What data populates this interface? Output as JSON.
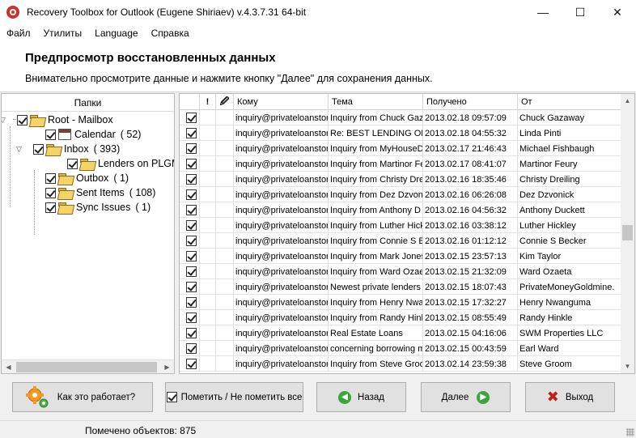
{
  "window": {
    "title": "Recovery Toolbox for Outlook (Eugene Shiriaev) v.4.3.7.31 64-bit",
    "minimize": "—",
    "maximize": "☐",
    "close": "✕"
  },
  "menu": [
    "Файл",
    "Утилиты",
    "Language",
    "Справка"
  ],
  "header": {
    "title": "Предпросмотр восстановленных данных",
    "subtitle": "Внимательно просмотрите данные и нажмите кнопку \"Далее\" для сохранения данных."
  },
  "folders": {
    "header": "Папки",
    "items": [
      {
        "label": "Root - Mailbox",
        "count": "",
        "checked": true,
        "expander": "▽",
        "icon": "folder-icon"
      },
      {
        "label": "Calendar",
        "count": "( 52)",
        "checked": true,
        "expander": "",
        "icon": "calendar-icon"
      },
      {
        "label": "Inbox",
        "count": "( 393)",
        "checked": true,
        "expander": "▽",
        "icon": "folder-icon"
      },
      {
        "label": "Lenders on PLGM",
        "count": "",
        "checked": true,
        "expander": "",
        "icon": "folder-icon"
      },
      {
        "label": "Outbox",
        "count": "( 1)",
        "checked": true,
        "expander": "",
        "icon": "folder-icon"
      },
      {
        "label": "Sent Items",
        "count": "( 108)",
        "checked": true,
        "expander": "",
        "icon": "folder-icon"
      },
      {
        "label": "Sync Issues",
        "count": "( 1)",
        "checked": true,
        "expander": "",
        "icon": "folder-icon"
      }
    ]
  },
  "grid": {
    "columns": [
      "",
      "!",
      "🖉",
      "Кому",
      "Тема",
      "Получено",
      "От"
    ],
    "rows": [
      {
        "to": "inquiry@privateloanstor",
        "subject": "Inquiry from Chuck Gaz",
        "received": "2013.02.18 09:57:09",
        "from": "Chuck Gazaway"
      },
      {
        "to": "inquiry@privateloanstor",
        "subject": "Re: BEST LENDING OPP",
        "received": "2013.02.18 04:55:32",
        "from": "Linda Pinti"
      },
      {
        "to": "inquiry@privateloanstor",
        "subject": "Inquiry from MyHouseD",
        "received": "2013.02.17 21:46:43",
        "from": "Michael Fishbaugh"
      },
      {
        "to": "inquiry@privateloanstor",
        "subject": "Inquiry from Martinor Fe",
        "received": "2013.02.17 08:41:07",
        "from": "Martinor Feury"
      },
      {
        "to": "inquiry@privateloanstor",
        "subject": "Inquiry from Christy Dre",
        "received": "2013.02.16 18:35:46",
        "from": "Christy Dreiling"
      },
      {
        "to": "inquiry@privateloanstor",
        "subject": "Inquiry from Dez Dzvon",
        "received": "2013.02.16 06:26:08",
        "from": "Dez Dzvonick"
      },
      {
        "to": "inquiry@privateloanstor",
        "subject": "Inquiry from Anthony D",
        "received": "2013.02.16 04:56:32",
        "from": "Anthony Duckett"
      },
      {
        "to": "inquiry@privateloanstor",
        "subject": "Inquiry from Luther Hick",
        "received": "2013.02.16 03:38:12",
        "from": "Luther Hickley"
      },
      {
        "to": "inquiry@privateloanstor",
        "subject": "Inquiry from Connie S B",
        "received": "2013.02.16 01:12:12",
        "from": "Connie S Becker"
      },
      {
        "to": "inquiry@privateloanstor",
        "subject": "Inquiry from Mark Jones",
        "received": "2013.02.15 23:57:13",
        "from": "Kim Taylor"
      },
      {
        "to": "inquiry@privateloanstor",
        "subject": "Inquiry from Ward Ozae",
        "received": "2013.02.15 21:32:09",
        "from": "Ward Ozaeta"
      },
      {
        "to": "inquiry@privateloanstor",
        "subject": "Newest private lenders",
        "received": "2013.02.15 18:07:43",
        "from": "PrivateMoneyGoldmine."
      },
      {
        "to": "inquiry@privateloanstor",
        "subject": "Inquiry from Henry Nwa",
        "received": "2013.02.15 17:32:27",
        "from": "Henry Nwanguma"
      },
      {
        "to": "inquiry@privateloanstor",
        "subject": "Inquiry from Randy Hinl",
        "received": "2013.02.15 08:55:49",
        "from": "Randy Hinkle"
      },
      {
        "to": "inquiry@privateloanstor",
        "subject": "Real Estate Loans",
        "received": "2013.02.15 04:16:06",
        "from": "SWM Properties LLC"
      },
      {
        "to": "inquiry@privateloanstor",
        "subject": "concerning borrowing m",
        "received": "2013.02.15 00:43:59",
        "from": "Earl Ward"
      },
      {
        "to": "inquiry@privateloanstor",
        "subject": "Inquiry from Steve Groo",
        "received": "2013.02.14 23:59:38",
        "from": "Steve Groom"
      }
    ]
  },
  "buttons": {
    "how_it_works": "Как это работает?",
    "toggle_mark": "Пометить / Не пометить все",
    "back": "Назад",
    "next": "Далее",
    "exit": "Выход"
  },
  "status": {
    "marked": "Помечено объектов: 875"
  },
  "colors": {
    "accent_green": "#3aa637",
    "exit_red": "#c0201a"
  }
}
